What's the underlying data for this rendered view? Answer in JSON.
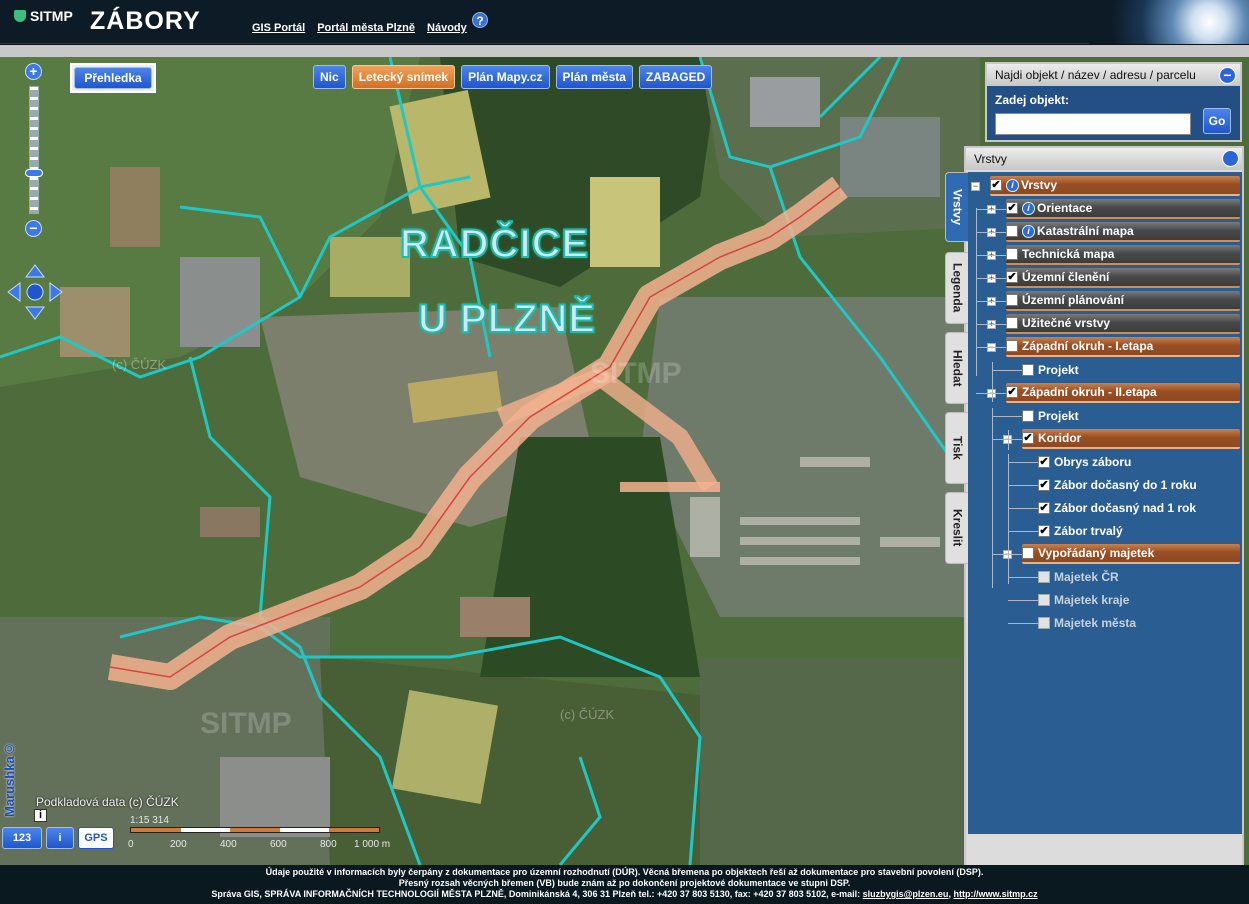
{
  "header": {
    "logo": "SITMP",
    "title": "ZÁBORY",
    "links": [
      "GIS Portál",
      "Portál města Plzně",
      "Návody"
    ],
    "help": "?"
  },
  "map": {
    "labels": [
      "RADČICE",
      "U PLZNĚ"
    ],
    "watermarks": [
      "(c) ČÚZK",
      "(c) ČÚZK",
      "SITMP",
      "SITMP"
    ],
    "prehledka": "Přehledka",
    "basemaps": [
      {
        "label": "Nic",
        "active": false
      },
      {
        "label": "Letecký snímek",
        "active": true
      },
      {
        "label": "Plán Mapy.cz",
        "active": false
      },
      {
        "label": "Plán města",
        "active": false
      },
      {
        "label": "ZABAGED",
        "active": false
      }
    ],
    "attribution": "Podkladová data (c) ČÚZK",
    "info_box": "i",
    "marushka": "Marushka©",
    "scale": {
      "ratio": "1:15 314",
      "ticks": [
        "0",
        "200",
        "400",
        "600",
        "800",
        "1 000 m"
      ]
    },
    "bottom_buttons": [
      "123",
      "i",
      "GPS"
    ],
    "colors": {
      "boundary": "#1fc8c4",
      "zone": "#f3b18f",
      "accent": "#2d64d6",
      "orange": "#d26f22"
    }
  },
  "search": {
    "title": "Najdi objekt / název / adresu / parcelu",
    "label": "Zadej objekt:",
    "value": "",
    "go": "Go"
  },
  "panel": {
    "title": "Vrstvy",
    "tabs": [
      "Vrstvy",
      "Legenda",
      "Hledat",
      "Tisk",
      "Kreslit"
    ],
    "tree": [
      {
        "label": "Vrstvy",
        "checked": true,
        "expander": "−",
        "info": true,
        "style": "orangegrp",
        "level": 0
      },
      {
        "label": "Orientace",
        "checked": true,
        "expander": "+",
        "info": true,
        "style": "group",
        "level": 1
      },
      {
        "label": "Katastrální mapa",
        "checked": false,
        "expander": "+",
        "info": true,
        "style": "group",
        "level": 1
      },
      {
        "label": "Technická mapa",
        "checked": false,
        "expander": "+",
        "info": false,
        "style": "group",
        "level": 1
      },
      {
        "label": "Územní členění",
        "checked": true,
        "expander": "+",
        "info": false,
        "style": "group",
        "level": 1
      },
      {
        "label": "Územní plánování",
        "checked": false,
        "expander": "+",
        "info": false,
        "style": "group",
        "level": 1
      },
      {
        "label": "Užitečné vrstvy",
        "checked": false,
        "expander": "+",
        "info": false,
        "style": "group",
        "level": 1
      },
      {
        "label": "Západní okruh - I.etapa",
        "checked": false,
        "expander": "−",
        "info": false,
        "style": "orangegrp",
        "level": 1
      },
      {
        "label": "Projekt",
        "checked": false,
        "expander": "",
        "info": false,
        "style": "plain",
        "level": 2
      },
      {
        "label": "Západní okruh - II.etapa",
        "checked": true,
        "expander": "−",
        "info": false,
        "style": "orangegrp",
        "level": 1
      },
      {
        "label": "Projekt",
        "checked": false,
        "expander": "",
        "info": false,
        "style": "plain",
        "level": 2
      },
      {
        "label": "Koridor",
        "checked": true,
        "expander": "−",
        "info": false,
        "style": "orangegrp",
        "level": 2
      },
      {
        "label": "Obrys záboru",
        "checked": true,
        "expander": "",
        "info": false,
        "style": "plain",
        "level": 3
      },
      {
        "label": "Zábor dočasný do 1 roku",
        "checked": true,
        "expander": "",
        "info": false,
        "style": "plain",
        "level": 3
      },
      {
        "label": "Zábor dočasný nad 1 rok",
        "checked": true,
        "expander": "",
        "info": false,
        "style": "plain",
        "level": 3
      },
      {
        "label": "Zábor trvalý",
        "checked": true,
        "expander": "",
        "info": false,
        "style": "plain",
        "level": 3
      },
      {
        "label": "Vypořádaný majetek",
        "checked": false,
        "expander": "−",
        "info": false,
        "style": "orangegrp",
        "level": 2
      },
      {
        "label": "Majetek ČR",
        "checked": false,
        "expander": "",
        "info": false,
        "style": "dim",
        "level": 3
      },
      {
        "label": "Majetek kraje",
        "checked": false,
        "expander": "",
        "info": false,
        "style": "dim",
        "level": 3
      },
      {
        "label": "Majetek města",
        "checked": false,
        "expander": "",
        "info": false,
        "style": "dim",
        "level": 3
      }
    ],
    "scroll_left": "‹",
    "scroll_right": "›"
  },
  "footer": {
    "line1": "Údaje použité v informacích byly čerpány z dokumentace pro územní rozhodnutí (DÚR). Věcná břemena po objektech řeší až dokumentace pro stavební povolení (DSP).",
    "line2": "Přesný rozsah věcných břemen (VB) bude znám až po dokončení projektové dokumentace ve stupni DSP.",
    "line3": "Správa GIS, SPRÁVA INFORMAČNÍCH TECHNOLOGIÍ MĚSTA PLZNĚ, Dominikánská 4, 306 31 Plzeň tel.: +420 37 803 5130, fax: +420 37 803 5102, e-mail:",
    "email": "sluzbygis@plzen.eu",
    "web": "http://www.sitmp.cz"
  }
}
